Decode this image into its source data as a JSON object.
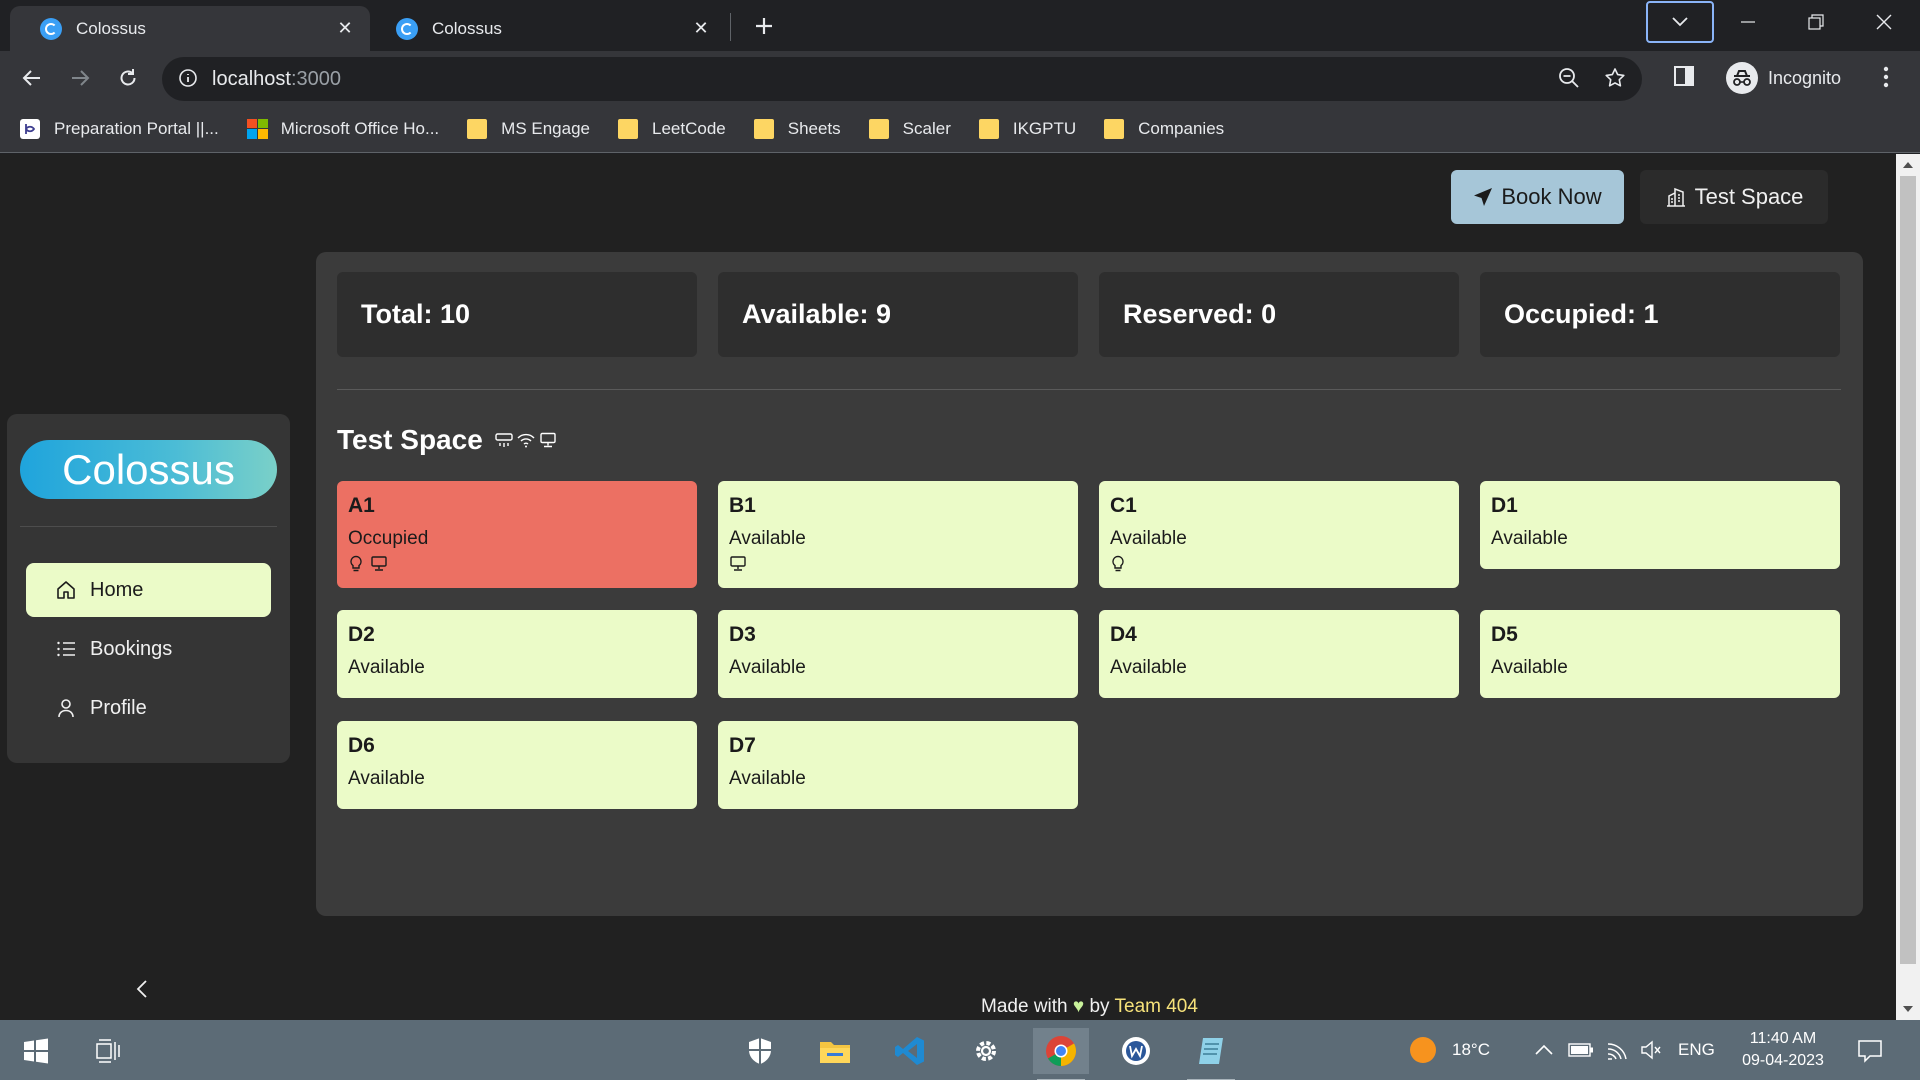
{
  "browser": {
    "tabs": [
      {
        "title": "Colossus",
        "active": true
      },
      {
        "title": "Colossus",
        "active": false
      }
    ],
    "address": {
      "host": "localhost",
      "port": ":3000"
    },
    "profile_label": "Incognito",
    "bookmarks": [
      {
        "label": "Preparation Portal ||...",
        "icon": "portal-icon"
      },
      {
        "label": "Microsoft Office Ho...",
        "icon": "microsoft-icon"
      },
      {
        "label": "MS Engage",
        "icon": "folder-icon"
      },
      {
        "label": "LeetCode",
        "icon": "folder-icon"
      },
      {
        "label": "Sheets",
        "icon": "folder-icon"
      },
      {
        "label": "Scaler",
        "icon": "folder-icon"
      },
      {
        "label": "IKGPTU",
        "icon": "folder-icon"
      },
      {
        "label": "Companies",
        "icon": "folder-icon"
      }
    ]
  },
  "header": {
    "book_now": "Book Now",
    "test_space": "Test Space"
  },
  "sidebar": {
    "logo": "Colossus",
    "items": [
      {
        "label": "Home",
        "icon": "home-icon",
        "active": true
      },
      {
        "label": "Bookings",
        "icon": "list-icon",
        "active": false
      },
      {
        "label": "Profile",
        "icon": "user-icon",
        "active": false
      }
    ]
  },
  "stats": {
    "total": "Total: 10",
    "available": "Available: 9",
    "reserved": "Reserved: 0",
    "occupied": "Occupied: 1"
  },
  "space": {
    "title": "Test Space",
    "amenities": [
      "air-conditioner-icon",
      "wifi-icon",
      "monitor-icon"
    ],
    "seats": [
      {
        "name": "A1",
        "status": "Occupied",
        "icons": [
          "bulb-icon",
          "monitor-icon"
        ]
      },
      {
        "name": "B1",
        "status": "Available",
        "icons": [
          "monitor-icon"
        ]
      },
      {
        "name": "C1",
        "status": "Available",
        "icons": [
          "bulb-icon"
        ]
      },
      {
        "name": "D1",
        "status": "Available",
        "icons": []
      },
      {
        "name": "D2",
        "status": "Available",
        "icons": []
      },
      {
        "name": "D3",
        "status": "Available",
        "icons": []
      },
      {
        "name": "D4",
        "status": "Available",
        "icons": []
      },
      {
        "name": "D5",
        "status": "Available",
        "icons": []
      },
      {
        "name": "D6",
        "status": "Available",
        "icons": []
      },
      {
        "name": "D7",
        "status": "Available",
        "icons": []
      }
    ]
  },
  "footer": {
    "made_with": "Made with",
    "heart": "♥",
    "by": "by",
    "team": "Team 404"
  },
  "taskbar": {
    "weather": "18°C",
    "language": "ENG",
    "time": "11:40 AM",
    "date": "09-04-2023"
  },
  "colors": {
    "occupied": "#ec7063",
    "available": "#ebfbc8",
    "accent_book": "#a6c6d8"
  }
}
